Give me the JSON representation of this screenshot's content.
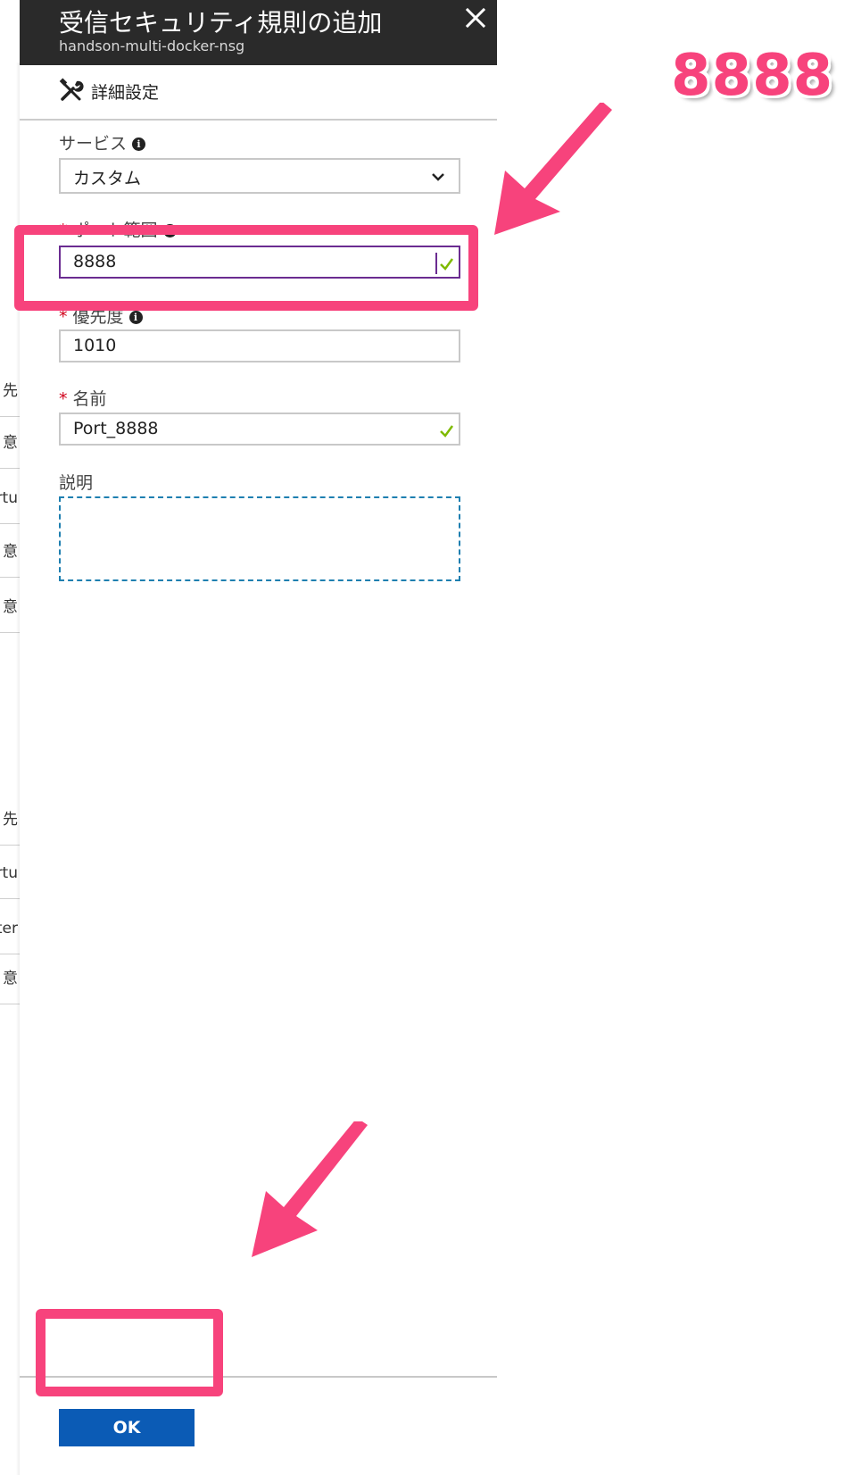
{
  "background_list": {
    "rows": [
      "先",
      "意",
      "rtu",
      "意",
      "意",
      "先",
      "rtu",
      "ter",
      "意"
    ]
  },
  "blade": {
    "title": "受信セキュリティ規則の追加",
    "subtitle": "handson-multi-docker-nsg",
    "close_icon": "close-icon",
    "tab_label": "詳細設定"
  },
  "form": {
    "service": {
      "label": "サービス",
      "value": "カスタム"
    },
    "port_range": {
      "label": "ポート範囲",
      "required": "*",
      "value": "8888"
    },
    "priority": {
      "label": "優先度",
      "required": "*",
      "value": "1010"
    },
    "name": {
      "label": "名前",
      "required": "*",
      "value": "Port_8888"
    },
    "description": {
      "label": "説明",
      "value": ""
    }
  },
  "footer": {
    "ok_label": "OK"
  },
  "annotation": {
    "text": "8888",
    "color": "#f7437c"
  }
}
